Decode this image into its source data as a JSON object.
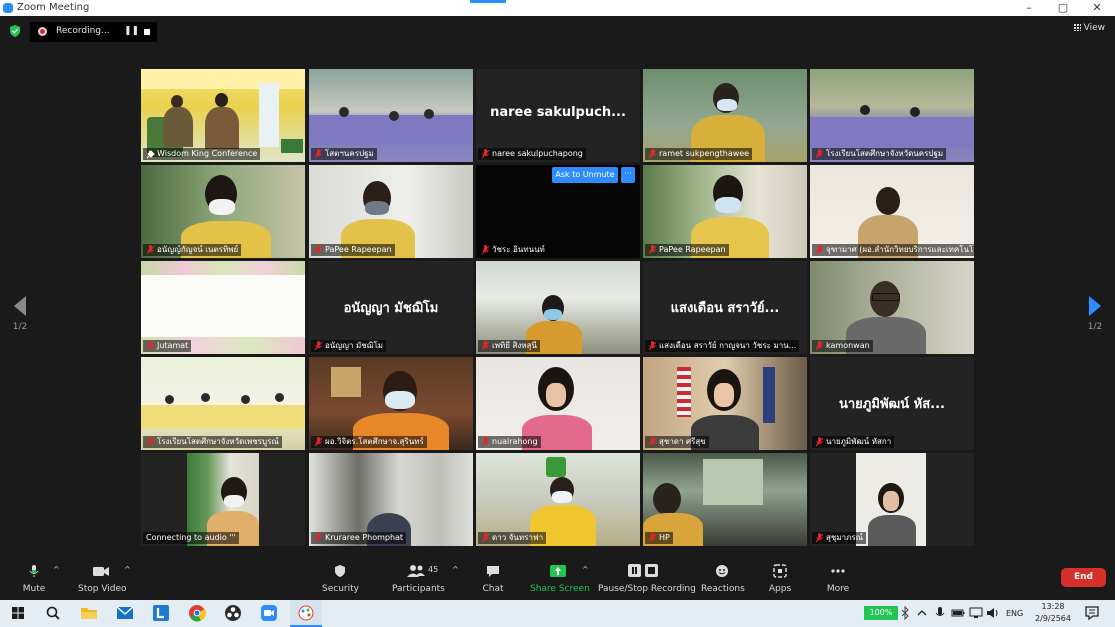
{
  "window": {
    "title": "Zoom Meeting"
  },
  "recording": {
    "label": "Recording..."
  },
  "view_label": "View",
  "pager": {
    "left": "1/2",
    "right": "1/2"
  },
  "ask_to_unmute": "Ask to Unmute",
  "more_options": "···",
  "tiles": [
    {
      "name": "Wisdom King Conference",
      "big": ""
    },
    {
      "name": "โสตฯนครปฐม",
      "big": ""
    },
    {
      "name": "naree sakulpuchapong",
      "big": "naree  sakulpuch..."
    },
    {
      "name": "ramet  sukpengthawee",
      "big": ""
    },
    {
      "name": "โรงเรียนโสตศึกษาจังหวัดนครปฐม",
      "big": ""
    },
    {
      "name": "อนัญญ์กัญจน์ เนตรทิพย์",
      "big": ""
    },
    {
      "name": "PaPee Rapeepan",
      "big": ""
    },
    {
      "name": "วัชระ อินทนนท์",
      "big": ""
    },
    {
      "name": "PaPee Rapeepan",
      "big": ""
    },
    {
      "name": "จุฑามาศ (ผอ.สำนักวิทยบริการและเทคโนโลยีส...",
      "big": ""
    },
    {
      "name": "Jutamat",
      "big": ""
    },
    {
      "name": "อนัญญา มัชฌิโม",
      "big": "อนัญญา มัชฌิโม"
    },
    {
      "name": "เพทิยี สิงหสุนี",
      "big": ""
    },
    {
      "name": "แสงเดือน สราวัย์ กาญจนา  วัชระ มาน...",
      "big": "แสงเดือน สราวัย์..."
    },
    {
      "name": "kamonwan",
      "big": ""
    },
    {
      "name": "โรงเรียนโสตศึกษาจังหวัดเพชรบูรณ์",
      "big": ""
    },
    {
      "name": "ผอ.วิจิตร.โสตศึกษาจ.สุรินทร์",
      "big": ""
    },
    {
      "name": "nualrahong",
      "big": ""
    },
    {
      "name": "สุชาดา ศรีสุข",
      "big": ""
    },
    {
      "name": "นายภูมิพัฒน์  หัสกา",
      "big": "นายภูมิพัฒน์  หัส..."
    },
    {
      "name": "Connecting to audio '''",
      "big": ""
    },
    {
      "name": "Kruraree Phomphat",
      "big": ""
    },
    {
      "name": "ดาว จันทราฟา",
      "big": ""
    },
    {
      "name": "HP",
      "big": ""
    },
    {
      "name": "สุชุมาภรณ์",
      "big": ""
    }
  ],
  "toolbar": {
    "mute": "Mute",
    "stop_video": "Stop Video",
    "security": "Security",
    "participants": "Participants",
    "participant_count": "45",
    "chat": "Chat",
    "share_screen": "Share Screen",
    "pause_stop_recording": "Pause/Stop Recording",
    "reactions": "Reactions",
    "apps": "Apps",
    "more": "More",
    "end": "End"
  },
  "taskbar": {
    "battery": "100%",
    "lang": "ENG",
    "time": "13:28",
    "date": "2/9/2564"
  },
  "colors": {
    "accent": "#2d8cff",
    "end": "#d7302b",
    "active_border": "#c8e22f",
    "share_green": "#23c552"
  }
}
